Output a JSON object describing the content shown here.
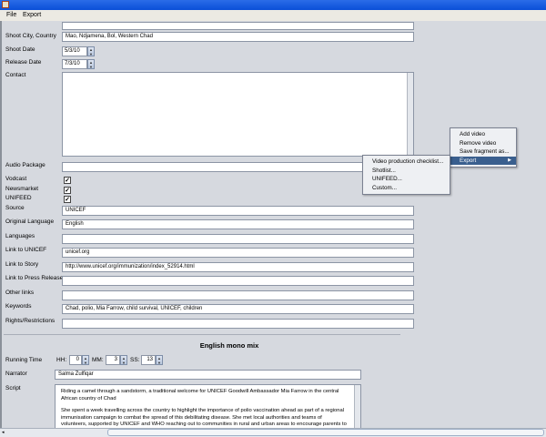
{
  "menubar": {
    "file": "File",
    "export": "Export"
  },
  "form": {
    "shoot_city_label": "Shoot City, Country",
    "shoot_city": "Mao, Ndjamena, Bol, Western Chad",
    "shoot_date_label": "Shoot Date",
    "shoot_date": "5/3/10",
    "release_date_label": "Release Date",
    "release_date": "7/3/10",
    "contact_label": "Contact",
    "contact": "",
    "audio_package_label": "Audio Package",
    "audio_package": "",
    "vodcast_label": "Vodcast",
    "newsmarket_label": "Newsmarket",
    "unifeed_label": "UNIFEED",
    "vodcast_checked": true,
    "newsmarket_checked": true,
    "unifeed_checked": true,
    "check_glyph": "✓",
    "source_label": "Source",
    "source": "UNICEF",
    "orig_lang_label": "Original Language",
    "orig_lang": "English",
    "languages_label": "Languages",
    "languages": "",
    "link_unicef_label": "Link to UNICEF",
    "link_unicef": "unicef.org",
    "link_story_label": "Link to Story",
    "link_story": "http://www.unicef.org/immunization/index_52914.html",
    "link_press_label": "Link to Press Release",
    "link_press": "",
    "other_links_label": "Other links",
    "other_links": "",
    "keywords_label": "Keywords",
    "keywords": "Chad, polio, Mia Farrow, child survival, UNICEF, children",
    "rights_label": "Rights/Restrictions",
    "rights": ""
  },
  "audio": {
    "title": "English mono mix",
    "running_time_label": "Running Time",
    "hh_label": "HH:",
    "mm_label": "MM:",
    "ss_label": "SS:",
    "hh": "0",
    "mm": "3",
    "ss": "13",
    "narrator_label": "Narrator",
    "narrator": "Salma Zulfiqar",
    "script_label": "Script",
    "script_p1": "Riding a camel through a sandstorm, a traditional welcome for UNICEF Goodwill Ambassador Mia Farrow in the central African country of Chad",
    "script_p2": "She spent a week travelling across the country to highlight the importance of polio vaccination ahead as part of a regional immunisation campaign to combat the spread of this debilitating disease. She met local authorities and teams of volunteers, supported by UNICEF and WHO reaching out to communities in rural and urban areas to encourage parents to have their children vaccinated."
  },
  "context_menu": {
    "items": [
      "Add video",
      "Remove video",
      "Save fragment as...",
      "Export"
    ],
    "arrow": "▶"
  },
  "export_submenu": {
    "items": [
      "Video production checklist...",
      "Shotlist...",
      "UNIFEED...",
      "Custom..."
    ]
  }
}
